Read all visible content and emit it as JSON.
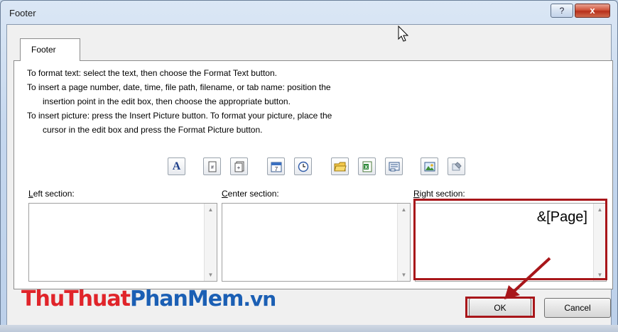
{
  "window": {
    "title": "Footer",
    "help_label": "?",
    "close_label": "x"
  },
  "tab": {
    "label": "Footer"
  },
  "instructions": {
    "line1": "To format text:  select the text, then choose the Format Text button.",
    "line2": "To insert a page number, date, time, file path, filename, or tab name:  position the",
    "line3": "insertion point in the edit box, then choose the appropriate button.",
    "line4": "To insert picture: press the Insert Picture button.  To format your picture, place the",
    "line5": "cursor in the edit box and press the Format Picture button."
  },
  "toolbar": {
    "buttons": [
      {
        "name": "format-text",
        "icon": "letter-a-icon",
        "glyph": "A"
      },
      {
        "name": "insert-page-number",
        "icon": "page-number-icon",
        "glyph": "#"
      },
      {
        "name": "insert-number-of-pages",
        "icon": "pages-count-icon",
        "glyph": "+"
      },
      {
        "name": "insert-date",
        "icon": "calendar-icon",
        "glyph": "7"
      },
      {
        "name": "insert-time",
        "icon": "clock-icon"
      },
      {
        "name": "insert-file-path",
        "icon": "folder-icon"
      },
      {
        "name": "insert-file-name",
        "icon": "excel-file-icon"
      },
      {
        "name": "insert-sheet-name",
        "icon": "sheet-tab-icon"
      },
      {
        "name": "insert-picture",
        "icon": "picture-icon"
      },
      {
        "name": "format-picture",
        "icon": "format-picture-icon"
      }
    ]
  },
  "sections": {
    "left": {
      "label_prefix": "",
      "label_underline": "L",
      "label_rest": "eft section:",
      "value": ""
    },
    "center": {
      "label_prefix": "",
      "label_underline": "C",
      "label_rest": "enter section:",
      "value": ""
    },
    "right": {
      "label_prefix": "",
      "label_underline": "R",
      "label_rest": "ight section:",
      "value": "&[Page]"
    }
  },
  "buttons": {
    "ok": "OK",
    "cancel": "Cancel"
  },
  "watermark": {
    "part1": "Thu",
    "part2": "Thuat",
    "part3": "PhanMem",
    "part4": ".vn"
  },
  "colors": {
    "highlight": "#a8161a",
    "watermark_red": "#e0242a",
    "watermark_blue": "#1b5fb4"
  }
}
